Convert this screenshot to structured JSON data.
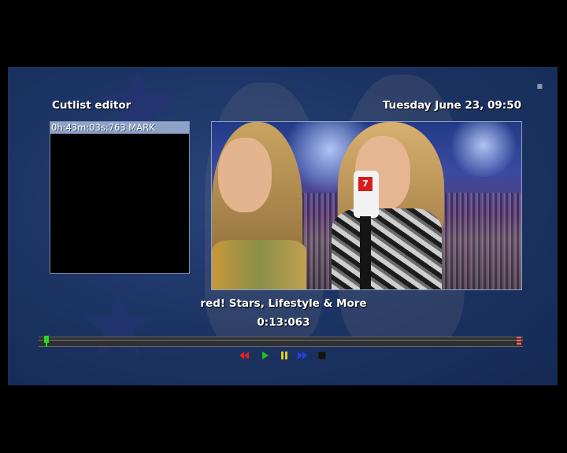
{
  "header": {
    "title": "Cutlist editor",
    "datetime": "Tuesday June 23, 09:50"
  },
  "cutlist": {
    "items": [
      {
        "label": "0h:43m:03s:763 MARK"
      }
    ]
  },
  "preview": {
    "mic_logo": "7"
  },
  "program": {
    "title": "red! Stars, Lifestyle & More",
    "timecode": "0:13:063"
  },
  "timeline": {
    "position_fraction": 0.01
  },
  "controls": [
    {
      "name": "rewind-button",
      "icon": "double-triangle-left",
      "color": "#e02020"
    },
    {
      "name": "play-button",
      "icon": "triangle-right",
      "color": "#20c020"
    },
    {
      "name": "pause-button",
      "icon": "pause-bars",
      "color": "#e0d020"
    },
    {
      "name": "fast-forward-button",
      "icon": "double-triangle-right",
      "color": "#2040e0"
    },
    {
      "name": "stop-button",
      "icon": "square",
      "color": "#111111"
    }
  ],
  "colors": {
    "selection": "#8fa3c8",
    "background": "#25416f"
  }
}
